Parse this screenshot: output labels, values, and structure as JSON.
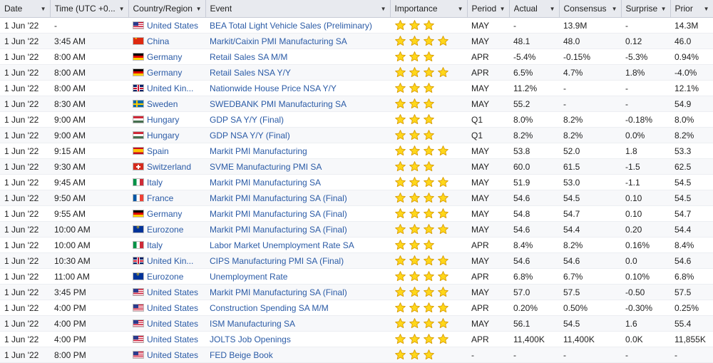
{
  "columns": [
    "Date",
    "Time (UTC +0...",
    "Country/Region",
    "Event",
    "Importance",
    "Period",
    "Actual",
    "Consensus",
    "Surprise",
    "Prior"
  ],
  "colors": {
    "link": "#2b5ba6",
    "star_fill": "#ffd71a",
    "star_stroke": "#d79a00",
    "header_bg": "#e8eaef"
  },
  "rows": [
    {
      "date": "1 Jun '22",
      "time": "-",
      "flag": "us",
      "country": "United States",
      "event": "BEA Total Light Vehicle Sales (Preliminary)",
      "importance": 3,
      "period": "MAY",
      "actual": "-",
      "consensus": "13.9M",
      "surprise": "-",
      "prior": "14.3M"
    },
    {
      "date": "1 Jun '22",
      "time": "3:45 AM",
      "flag": "cn",
      "country": "China",
      "event": "Markit/Caixin PMI Manufacturing SA",
      "importance": 4,
      "period": "MAY",
      "actual": "48.1",
      "consensus": "48.0",
      "surprise": "0.12",
      "prior": "46.0"
    },
    {
      "date": "1 Jun '22",
      "time": "8:00 AM",
      "flag": "de",
      "country": "Germany",
      "event": "Retail Sales SA M/M",
      "importance": 3,
      "period": "APR",
      "actual": "-5.4%",
      "consensus": "-0.15%",
      "surprise": "-5.3%",
      "prior": "0.94%"
    },
    {
      "date": "1 Jun '22",
      "time": "8:00 AM",
      "flag": "de",
      "country": "Germany",
      "event": "Retail Sales NSA Y/Y",
      "importance": 4,
      "period": "APR",
      "actual": "6.5%",
      "consensus": "4.7%",
      "surprise": "1.8%",
      "prior": "-4.0%"
    },
    {
      "date": "1 Jun '22",
      "time": "8:00 AM",
      "flag": "gb",
      "country": "United Kin...",
      "event": "Nationwide House Price NSA Y/Y",
      "importance": 3,
      "period": "MAY",
      "actual": "11.2%",
      "consensus": "-",
      "surprise": "-",
      "prior": "12.1%"
    },
    {
      "date": "1 Jun '22",
      "time": "8:30 AM",
      "flag": "se",
      "country": "Sweden",
      "event": "SWEDBANK PMI Manufacturing SA",
      "importance": 3,
      "period": "MAY",
      "actual": "55.2",
      "consensus": "-",
      "surprise": "-",
      "prior": "54.9"
    },
    {
      "date": "1 Jun '22",
      "time": "9:00 AM",
      "flag": "hu",
      "country": "Hungary",
      "event": "GDP SA Y/Y (Final)",
      "importance": 3,
      "period": "Q1",
      "actual": "8.0%",
      "consensus": "8.2%",
      "surprise": "-0.18%",
      "prior": "8.0%"
    },
    {
      "date": "1 Jun '22",
      "time": "9:00 AM",
      "flag": "hu",
      "country": "Hungary",
      "event": "GDP NSA Y/Y (Final)",
      "importance": 3,
      "period": "Q1",
      "actual": "8.2%",
      "consensus": "8.2%",
      "surprise": "0.0%",
      "prior": "8.2%"
    },
    {
      "date": "1 Jun '22",
      "time": "9:15 AM",
      "flag": "es",
      "country": "Spain",
      "event": "Markit PMI Manufacturing",
      "importance": 4,
      "period": "MAY",
      "actual": "53.8",
      "consensus": "52.0",
      "surprise": "1.8",
      "prior": "53.3"
    },
    {
      "date": "1 Jun '22",
      "time": "9:30 AM",
      "flag": "ch",
      "country": "Switzerland",
      "event": "SVME Manufacturing PMI SA",
      "importance": 3,
      "period": "MAY",
      "actual": "60.0",
      "consensus": "61.5",
      "surprise": "-1.5",
      "prior": "62.5"
    },
    {
      "date": "1 Jun '22",
      "time": "9:45 AM",
      "flag": "it",
      "country": "Italy",
      "event": "Markit PMI Manufacturing SA",
      "importance": 4,
      "period": "MAY",
      "actual": "51.9",
      "consensus": "53.0",
      "surprise": "-1.1",
      "prior": "54.5"
    },
    {
      "date": "1 Jun '22",
      "time": "9:50 AM",
      "flag": "fr",
      "country": "France",
      "event": "Markit PMI Manufacturing SA (Final)",
      "importance": 4,
      "period": "MAY",
      "actual": "54.6",
      "consensus": "54.5",
      "surprise": "0.10",
      "prior": "54.5"
    },
    {
      "date": "1 Jun '22",
      "time": "9:55 AM",
      "flag": "de",
      "country": "Germany",
      "event": "Markit PMI Manufacturing SA (Final)",
      "importance": 4,
      "period": "MAY",
      "actual": "54.8",
      "consensus": "54.7",
      "surprise": "0.10",
      "prior": "54.7"
    },
    {
      "date": "1 Jun '22",
      "time": "10:00 AM",
      "flag": "eu",
      "country": "Eurozone",
      "event": "Markit PMI Manufacturing SA (Final)",
      "importance": 4,
      "period": "MAY",
      "actual": "54.6",
      "consensus": "54.4",
      "surprise": "0.20",
      "prior": "54.4"
    },
    {
      "date": "1 Jun '22",
      "time": "10:00 AM",
      "flag": "it",
      "country": "Italy",
      "event": "Labor Market Unemployment Rate SA",
      "importance": 3,
      "period": "APR",
      "actual": "8.4%",
      "consensus": "8.2%",
      "surprise": "0.16%",
      "prior": "8.4%"
    },
    {
      "date": "1 Jun '22",
      "time": "10:30 AM",
      "flag": "gb",
      "country": "United Kin...",
      "event": "CIPS Manufacturing PMI SA (Final)",
      "importance": 4,
      "period": "MAY",
      "actual": "54.6",
      "consensus": "54.6",
      "surprise": "0.0",
      "prior": "54.6"
    },
    {
      "date": "1 Jun '22",
      "time": "11:00 AM",
      "flag": "eu",
      "country": "Eurozone",
      "event": "Unemployment Rate",
      "importance": 4,
      "period": "APR",
      "actual": "6.8%",
      "consensus": "6.7%",
      "surprise": "0.10%",
      "prior": "6.8%"
    },
    {
      "date": "1 Jun '22",
      "time": "3:45 PM",
      "flag": "us",
      "country": "United States",
      "event": "Markit PMI Manufacturing SA (Final)",
      "importance": 4,
      "period": "MAY",
      "actual": "57.0",
      "consensus": "57.5",
      "surprise": "-0.50",
      "prior": "57.5"
    },
    {
      "date": "1 Jun '22",
      "time": "4:00 PM",
      "flag": "us",
      "country": "United States",
      "event": "Construction Spending SA M/M",
      "importance": 4,
      "period": "APR",
      "actual": "0.20%",
      "consensus": "0.50%",
      "surprise": "-0.30%",
      "prior": "0.25%"
    },
    {
      "date": "1 Jun '22",
      "time": "4:00 PM",
      "flag": "us",
      "country": "United States",
      "event": "ISM Manufacturing SA",
      "importance": 4,
      "period": "MAY",
      "actual": "56.1",
      "consensus": "54.5",
      "surprise": "1.6",
      "prior": "55.4"
    },
    {
      "date": "1 Jun '22",
      "time": "4:00 PM",
      "flag": "us",
      "country": "United States",
      "event": "JOLTS Job Openings",
      "importance": 4,
      "period": "APR",
      "actual": "11,400K",
      "consensus": "11,400K",
      "surprise": "0.0K",
      "prior": "11,855K"
    },
    {
      "date": "1 Jun '22",
      "time": "8:00 PM",
      "flag": "us",
      "country": "United States",
      "event": "FED Beige Book",
      "importance": 3,
      "period": "-",
      "actual": "-",
      "consensus": "-",
      "surprise": "-",
      "prior": "-"
    }
  ]
}
